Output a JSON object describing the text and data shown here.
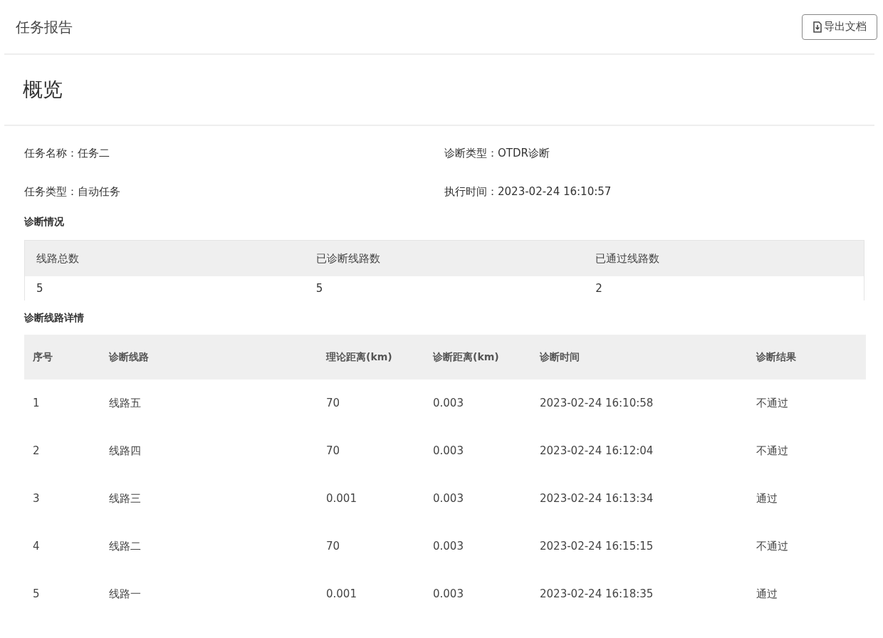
{
  "header": {
    "title": "任务报告",
    "export_button": "导出文档"
  },
  "overview": {
    "title": "概览",
    "fields": [
      {
        "label": "任务名称：",
        "value": "任务二"
      },
      {
        "label": "诊断类型：",
        "value": "OTDR诊断"
      },
      {
        "label": "任务类型：",
        "value": "自动任务"
      },
      {
        "label": "执行时间：",
        "value": "2023-02-24 16:10:57"
      }
    ]
  },
  "summary": {
    "title": "诊断情况",
    "columns": [
      "线路总数",
      "已诊断线路数",
      "已通过线路数"
    ],
    "values": [
      "5",
      "5",
      "2"
    ]
  },
  "details": {
    "title": "诊断线路详情",
    "columns": [
      "序号",
      "诊断线路",
      "理论距离(km)",
      "诊断距离(km)",
      "诊断时间",
      "诊断结果"
    ],
    "rows": [
      [
        "1",
        "线路五",
        "70",
        "0.003",
        "2023-02-24 16:10:58",
        "不通过"
      ],
      [
        "2",
        "线路四",
        "70",
        "0.003",
        "2023-02-24 16:12:04",
        "不通过"
      ],
      [
        "3",
        "线路三",
        "0.001",
        "0.003",
        "2023-02-24 16:13:34",
        "通过"
      ],
      [
        "4",
        "线路二",
        "70",
        "0.003",
        "2023-02-24 16:15:15",
        "不通过"
      ],
      [
        "5",
        "线路一",
        "0.001",
        "0.003",
        "2023-02-24 16:18:35",
        "通过"
      ]
    ]
  }
}
